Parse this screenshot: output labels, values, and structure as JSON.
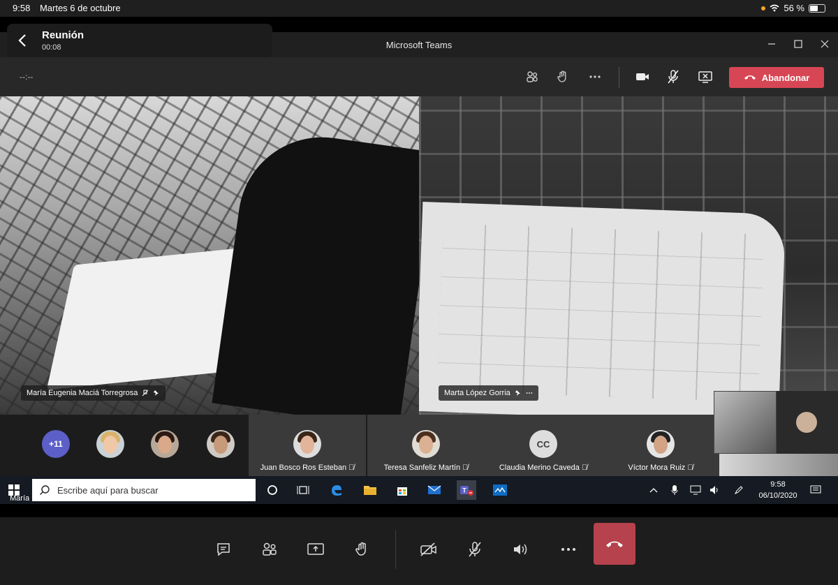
{
  "status_bar": {
    "time": "9:58",
    "date": "Martes 6 de octubre",
    "battery": "56 %",
    "battery_level": 0.56
  },
  "meeting": {
    "title": "Reunión",
    "elapsed": "00:08"
  },
  "window": {
    "title": "Microsoft Teams"
  },
  "toolbar": {
    "timer": "--:--",
    "leave_label": "Abandonar",
    "leave_color": "#d74654"
  },
  "videos": [
    {
      "name": "María Eugenia Maciá Torregrosa"
    },
    {
      "name": "Marta López Gorria"
    }
  ],
  "participants": {
    "overflow_count": "+11",
    "tiles": [
      {
        "name": "Juan Bosco Ros Esteban"
      },
      {
        "name": "Teresa Sanfeliz Martín"
      },
      {
        "name": "Claudia Merino Caveda",
        "initials": "CC"
      },
      {
        "name": "Víctor Mora Ruiz"
      }
    ]
  },
  "taskbar": {
    "user": "María",
    "search_placeholder": "Escribe aquí para buscar",
    "time": "9:58",
    "date": "06/10/2020"
  },
  "icons": [
    "chevron-left-icon",
    "participants-icon",
    "raise-hand-icon",
    "more-icon",
    "camera-icon",
    "mic-off-icon",
    "share-screen-icon",
    "phone-hangup-icon",
    "chat-icon",
    "speaker-icon",
    "windows-icon",
    "search-icon",
    "edge-icon",
    "folder-icon",
    "store-icon",
    "mail-icon",
    "teams-icon",
    "whiteboard-icon",
    "wifi-icon"
  ]
}
